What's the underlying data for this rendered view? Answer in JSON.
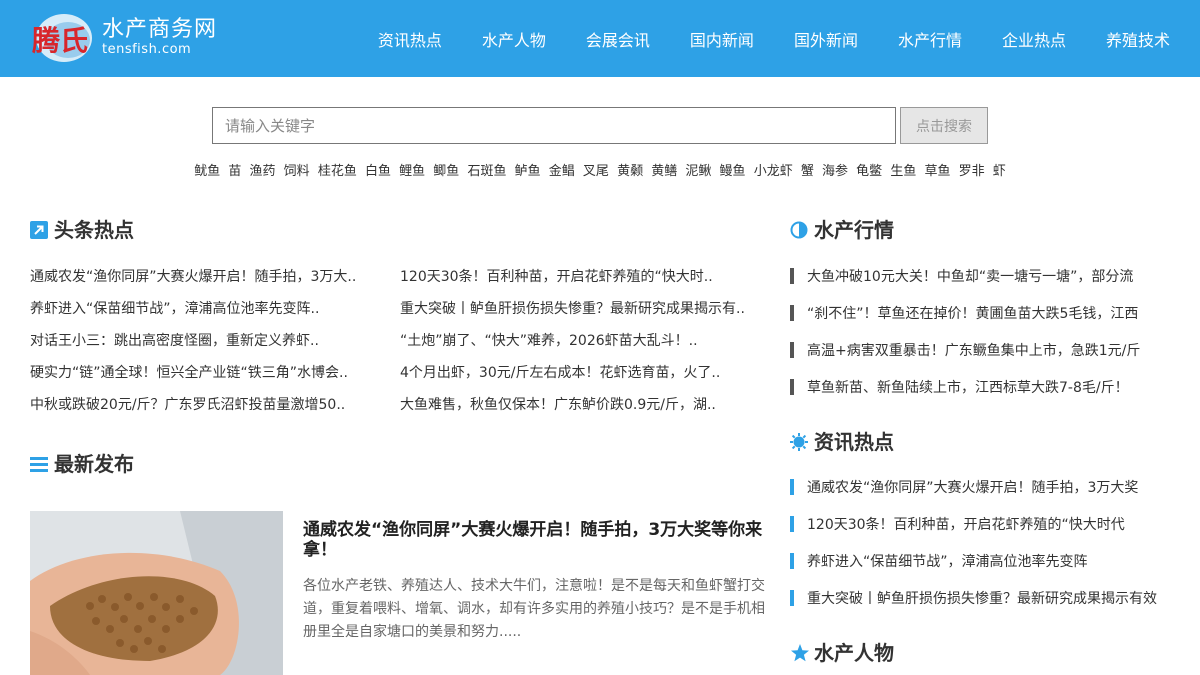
{
  "header": {
    "logo_badge": "腾氏",
    "logo_cn": "水产商务网",
    "logo_en": "tensfish.com",
    "nav": [
      "资讯热点",
      "水产人物",
      "会展会讯",
      "国内新闻",
      "国外新闻",
      "水产行情",
      "企业热点",
      "养殖技术"
    ]
  },
  "search": {
    "placeholder": "请输入关键字",
    "button": "点击搜索",
    "tags": [
      "鱿鱼",
      "苗",
      "渔药",
      "饲料",
      "桂花鱼",
      "白鱼",
      "鲤鱼",
      "鲫鱼",
      "石斑鱼",
      "鲈鱼",
      "金鲳",
      "叉尾",
      "黄颡",
      "黄鳝",
      "泥鳅",
      "鳗鱼",
      "小龙虾",
      "蟹",
      "海参",
      "龟鳖",
      "生鱼",
      "草鱼",
      "罗非",
      "虾"
    ]
  },
  "headlines": {
    "title": "头条热点",
    "items": [
      "通威农发“渔你同屏”大赛火爆开启！随手拍，3万大..",
      "120天30条！百利种苗，开启花虾养殖的“快大时..",
      "养虾进入“保苗细节战”，漳浦高位池率先变阵..",
      "重大突破丨鲈鱼肝损伤损失惨重？最新研究成果揭示有..",
      "对话王小三：跳出高密度怪圈，重新定义养虾..",
      "“土炮”崩了、“快大”难养，2026虾苗大乱斗！..",
      "硬实力“链”通全球！恒兴全产业链“铁三角”水博会..",
      "4个月出虾，30元/斤左右成本！花虾选育苗，火了..",
      "中秋或跌破20元/斤？广东罗氏沼虾投苗量激增50..",
      "大鱼难售，秋鱼仅保本！广东鲈价跌0.9元/斤，湖.."
    ]
  },
  "latest": {
    "title": "最新发布",
    "feature_title": "通威农发“渔你同屏”大赛火爆开启！随手拍，3万大奖等你来拿！",
    "feature_desc": "各位水产老铁、养殖达人、技术大牛们，注意啦！是不是每天和鱼虾蟹打交道，重复着喂料、增氧、调水，却有许多实用的养殖小技巧？是不是手机相册里全是自家塘口的美景和努力....."
  },
  "market": {
    "title": "水产行情",
    "items": [
      "大鱼冲破10元大关！中鱼却“卖一塘亏一塘”，部分流",
      "“刹不住”！草鱼还在掉价！黄圃鱼苗大跌5毛钱，江西",
      "高温+病害双重暴击！广东鳜鱼集中上市，急跌1元/斤",
      "草鱼新苗、新鱼陆续上市，江西标草大跌7-8毛/斤！"
    ]
  },
  "news": {
    "title": "资讯热点",
    "items": [
      "通威农发“渔你同屏”大赛火爆开启！随手拍，3万大奖",
      "120天30条！百利种苗，开启花虾养殖的“快大时代",
      "养虾进入“保苗细节战”，漳浦高位池率先变阵",
      "重大突破丨鲈鱼肝损伤损失惨重？最新研究成果揭示有效"
    ]
  },
  "people": {
    "title": "水产人物"
  },
  "colors": {
    "header_bg": "#2ea1e6",
    "accent": "#2ea1e6"
  }
}
